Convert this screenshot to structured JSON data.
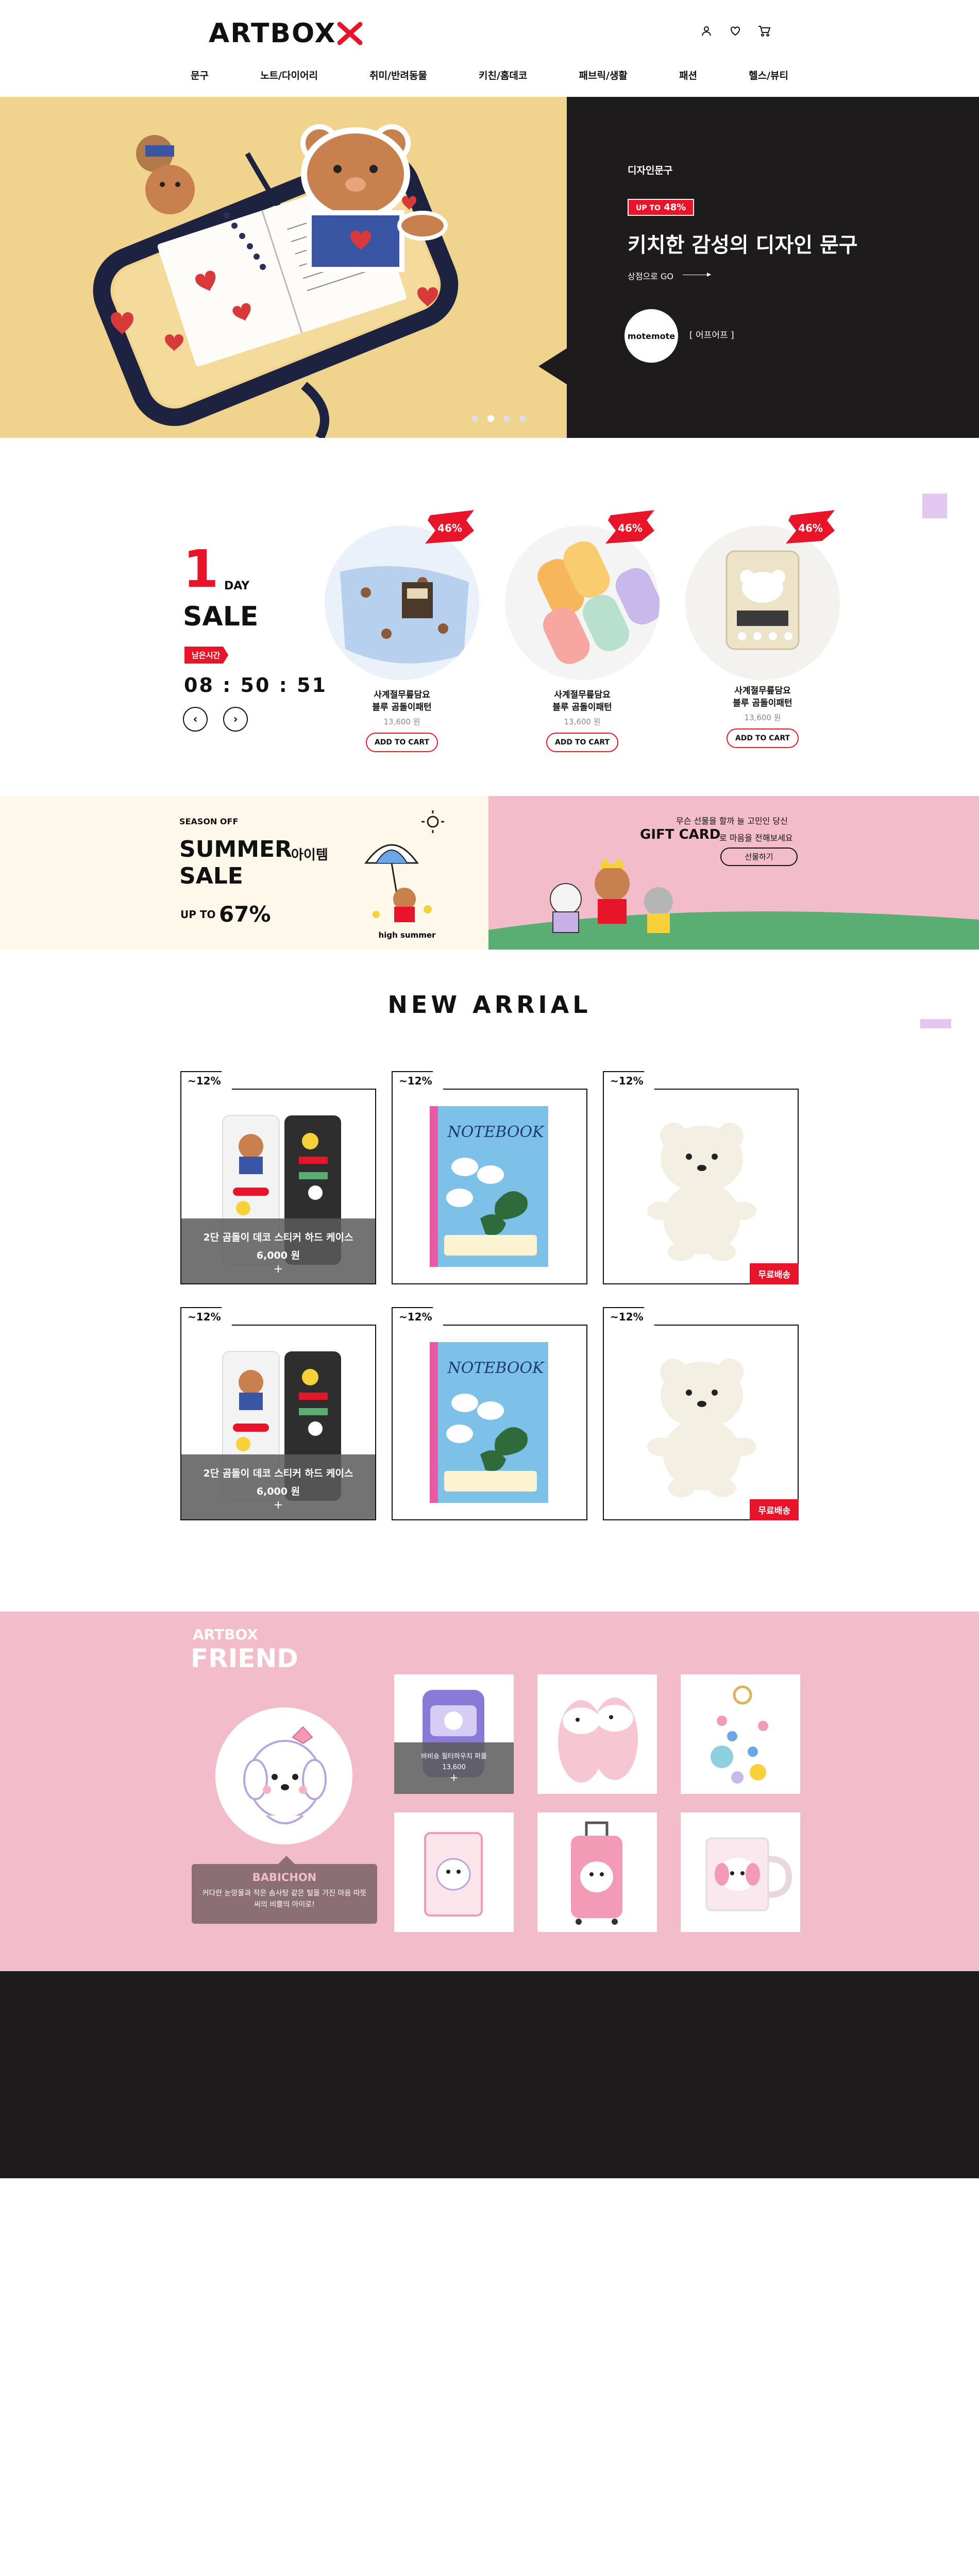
{
  "header": {
    "logo": "ARTBOX",
    "logo_mark": "✕",
    "icons": [
      "user-icon",
      "heart-icon",
      "cart-icon"
    ],
    "nav": [
      "문구",
      "노트/다이어리",
      "취미/반려동물",
      "키친/홈데코",
      "패브릭/생활",
      "패션",
      "헬스/뷰티"
    ]
  },
  "hero": {
    "category": "디자인문구",
    "badge_prefix": "UP TO",
    "badge_pct": "48%",
    "title": "키치한 감성의 디자인 문구",
    "link_label": "상점으로 GO",
    "brand": "motemote",
    "brand_label": "[ 어프어프 ]",
    "slide_count": 4,
    "active_slide": 2
  },
  "oneday": {
    "number": "1",
    "day_label": "DAY",
    "sale_label": "SALE",
    "remain_label": "남은시간",
    "timer": "08 : 50 : 51",
    "prev_icon": "chevron-left-icon",
    "next_icon": "chevron-right-icon",
    "products": [
      {
        "discount": "46%",
        "name_line1": "사계절무릎담요",
        "name_line2": "블루 곰돌이패턴",
        "price": "13,600 원",
        "button": "ADD TO CART"
      },
      {
        "discount": "46%",
        "name_line1": "사계절무릎담요",
        "name_line2": "블루 곰돌이패턴",
        "price": "13,600 원",
        "button": "ADD TO CART"
      },
      {
        "discount": "46%",
        "name_line1": "사계절무릎담요",
        "name_line2": "블루 곰돌이패턴",
        "price": "13,600 원",
        "button": "ADD TO CART"
      }
    ]
  },
  "season": {
    "label": "SEASON OFF",
    "title1": "SUMMER",
    "title1_suffix": "아이템",
    "title2": "SALE",
    "up_to": "UP TO",
    "pct": "67%",
    "illustration_text": "high summer",
    "gift_sub": "무슨 선물을 할까 늘 고민인 당신",
    "gift_title": "GIFT CARD",
    "gift_sub2": "로 마음을 전해보세요",
    "gift_button": "선물하기"
  },
  "new_arrival": {
    "title": "NEW ARRIAL",
    "items": [
      {
        "tag": "~12%",
        "type": "stickers",
        "name": "2단 곰돌이 데코 스티커 하드 케이스",
        "price": "6,000 원",
        "plus": "+",
        "hover": true
      },
      {
        "tag": "~12%",
        "type": "notebook",
        "free": false
      },
      {
        "tag": "~12%",
        "type": "bear",
        "free": true,
        "free_label": "무료배송"
      },
      {
        "tag": "~12%",
        "type": "stickers",
        "name": "2단 곰돌이 데코 스티커 하드 케이스",
        "price": "6,000 원",
        "plus": "+",
        "hover": true
      },
      {
        "tag": "~12%",
        "type": "notebook",
        "free": false
      },
      {
        "tag": "~12%",
        "type": "bear",
        "free": true,
        "free_label": "무료배송"
      }
    ],
    "notebook_text": "NOTEBOOK"
  },
  "friend": {
    "sub": "ARTBOX",
    "title": "FRIEND",
    "character_name": "BABICHON",
    "character_desc": "커다란 눈망울과 작은 솜사탕 같은 털을 가진 마음 따뜻씨의 비쁠의 아이로!",
    "items": [
      {
        "type": "pouch",
        "name": "바비숑 필터하우치 퍼플",
        "price": "13,600",
        "plus": "+",
        "hover": true
      },
      {
        "type": "slippers"
      },
      {
        "type": "keyring"
      },
      {
        "type": "can"
      },
      {
        "type": "suitcase"
      },
      {
        "type": "mug"
      }
    ]
  },
  "colors": {
    "accent": "#e8152a",
    "hero_yellow": "#f0d48e",
    "dark": "#1d1b1c",
    "pink": "#f3bccb",
    "cream": "#fdf8ea",
    "lavender": "#e2c8f0"
  }
}
